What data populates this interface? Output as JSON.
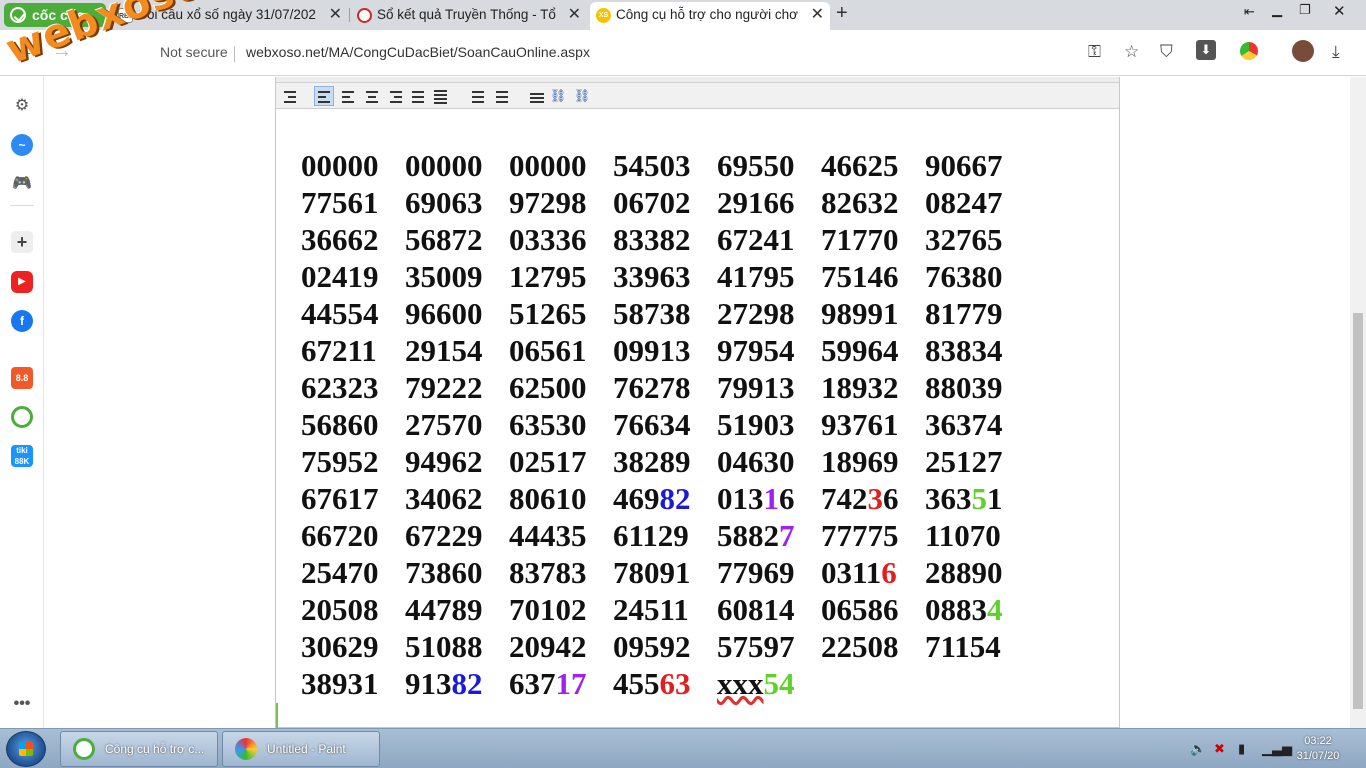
{
  "browser": {
    "brand": "cốc cốc",
    "tabs": [
      {
        "label": "Soi cầu xổ số ngày 31/07/202",
        "favicon": "RBK"
      },
      {
        "label": "Sổ kết quả Truyền Thống - Tổ",
        "favicon": ""
      },
      {
        "label": "Công cụ hỗ trợ cho người chơ",
        "favicon": "XS"
      }
    ],
    "not_secure": "Not secure",
    "url": "webxoso.net/MA/CongCuDacBiet/SoanCauOnline.aspx",
    "watermark": "webxoso.net"
  },
  "icons": {
    "back": "back-arrow-icon",
    "forward": "forward-arrow-icon",
    "reload": "reload-icon",
    "key": "key-icon",
    "star": "star-icon",
    "shield": "shield-icon",
    "download": "download-icon"
  },
  "colors": {
    "blue": "#1a1adb",
    "purple": "#a020f0",
    "red": "#e02020",
    "green": "#5ed22b",
    "black": "#111111"
  },
  "grid": [
    [
      [
        "00000"
      ],
      [
        "00000"
      ],
      [
        "00000"
      ],
      [
        "54503"
      ],
      [
        "69550"
      ],
      [
        "46625"
      ],
      [
        "90667"
      ]
    ],
    [
      [
        "77561"
      ],
      [
        "69063"
      ],
      [
        "97298"
      ],
      [
        "06702"
      ],
      [
        "29166"
      ],
      [
        "82632"
      ],
      [
        "08247"
      ]
    ],
    [
      [
        "36662"
      ],
      [
        "56872"
      ],
      [
        "03336"
      ],
      [
        "83382"
      ],
      [
        "67241"
      ],
      [
        "71770"
      ],
      [
        "32765"
      ]
    ],
    [
      [
        "02419"
      ],
      [
        "35009"
      ],
      [
        "12795"
      ],
      [
        "33963"
      ],
      [
        "41795"
      ],
      [
        "75146"
      ],
      [
        "76380"
      ]
    ],
    [
      [
        "44554"
      ],
      [
        "96600"
      ],
      [
        "51265"
      ],
      [
        "58738"
      ],
      [
        "27298"
      ],
      [
        "98991"
      ],
      [
        "81779"
      ]
    ],
    [
      [
        "67211"
      ],
      [
        "29154"
      ],
      [
        "06561"
      ],
      [
        "09913"
      ],
      [
        "97954"
      ],
      [
        "59964"
      ],
      [
        "83834"
      ]
    ],
    [
      [
        "62323"
      ],
      [
        "79222"
      ],
      [
        "62500"
      ],
      [
        "76278"
      ],
      [
        "79913"
      ],
      [
        "18932"
      ],
      [
        "88039"
      ]
    ],
    [
      [
        "56860"
      ],
      [
        "27570"
      ],
      [
        "63530"
      ],
      [
        "76634"
      ],
      [
        "51903"
      ],
      [
        "93761"
      ],
      [
        "36374"
      ]
    ],
    [
      [
        "75952"
      ],
      [
        "94962"
      ],
      [
        "02517"
      ],
      [
        "38289"
      ],
      [
        "04630"
      ],
      [
        "18969"
      ],
      [
        "25127"
      ]
    ],
    [
      [
        "67617"
      ],
      [
        "34062"
      ],
      [
        "80610"
      ],
      [
        "469",
        "82",
        "blue"
      ],
      [
        "013",
        "1",
        "purple",
        "6"
      ],
      [
        "742",
        "3",
        "red",
        "6"
      ],
      [
        "363",
        "5",
        "green",
        "1"
      ]
    ],
    [
      [
        "66720"
      ],
      [
        "67229"
      ],
      [
        "44435"
      ],
      [
        "61129"
      ],
      [
        "5882",
        "7",
        "purple"
      ],
      [
        "77775"
      ],
      [
        "11070"
      ]
    ],
    [
      [
        "25470"
      ],
      [
        "73860"
      ],
      [
        "83783"
      ],
      [
        "78091"
      ],
      [
        "77969"
      ],
      [
        "0311",
        "6",
        "red"
      ],
      [
        "28890"
      ]
    ],
    [
      [
        "20508"
      ],
      [
        "44789"
      ],
      [
        "70102"
      ],
      [
        "24511"
      ],
      [
        "60814"
      ],
      [
        "06586"
      ],
      [
        "0883",
        "4",
        "green"
      ]
    ],
    [
      [
        "30629"
      ],
      [
        "51088"
      ],
      [
        "20942"
      ],
      [
        "09592"
      ],
      [
        "57597"
      ],
      [
        "22508"
      ],
      [
        "71154"
      ]
    ],
    [
      [
        "38931"
      ],
      [
        "913",
        "82",
        "blue"
      ],
      [
        "637",
        "17",
        "purple"
      ],
      [
        "455",
        "63",
        "red"
      ],
      [
        "xxx",
        "54",
        "green"
      ]
    ]
  ],
  "taskbar": {
    "tasks": [
      {
        "label": "Công cụ hỗ trợ c..."
      },
      {
        "label": "Untitled - Paint"
      }
    ],
    "time": "03:22",
    "date": "31/07/20"
  }
}
